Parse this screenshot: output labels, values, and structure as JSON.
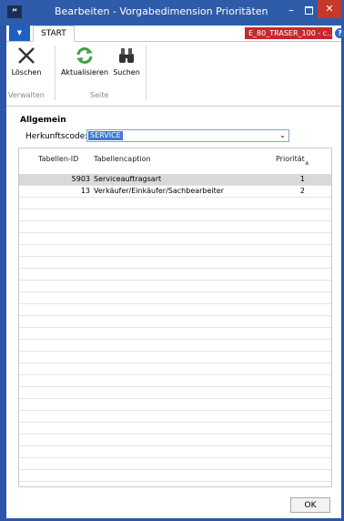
{
  "window": {
    "title": "Bearbeiten - Vorgabedimension Prioritäten",
    "logo_text": "ᴹ",
    "minimize": "–",
    "close": "✕"
  },
  "ribbon": {
    "tab_start": "START",
    "company": "E_80_TRASER_100 - c...",
    "help": "?",
    "buttons": {
      "delete": "Löschen",
      "refresh": "Aktualisieren",
      "search": "Suchen"
    },
    "groups": {
      "manage": "Verwalten",
      "page": "Seite"
    }
  },
  "form": {
    "section_title": "Allgemein",
    "origin_label": "Herkunftscode:",
    "origin_value": "SERVICE",
    "dropdown_arrow": "⌄"
  },
  "grid": {
    "columns": {
      "table_id": "Tabellen-ID",
      "caption": "Tabellencaption",
      "priority": "Priorität",
      "sort": "▲"
    },
    "rows": [
      {
        "table_id": "5903",
        "caption": "Serviceauftragsart",
        "priority": "1"
      },
      {
        "table_id": "13",
        "caption": "Verkäufer/Einkäufer/Sachbearbeiter",
        "priority": "2"
      }
    ]
  },
  "footer": {
    "ok_label": "OK"
  },
  "colors": {
    "titlebar": "#2e5ca8",
    "close": "#c7382c",
    "company_badge": "#c6282e",
    "selection": "#3d78d6"
  }
}
